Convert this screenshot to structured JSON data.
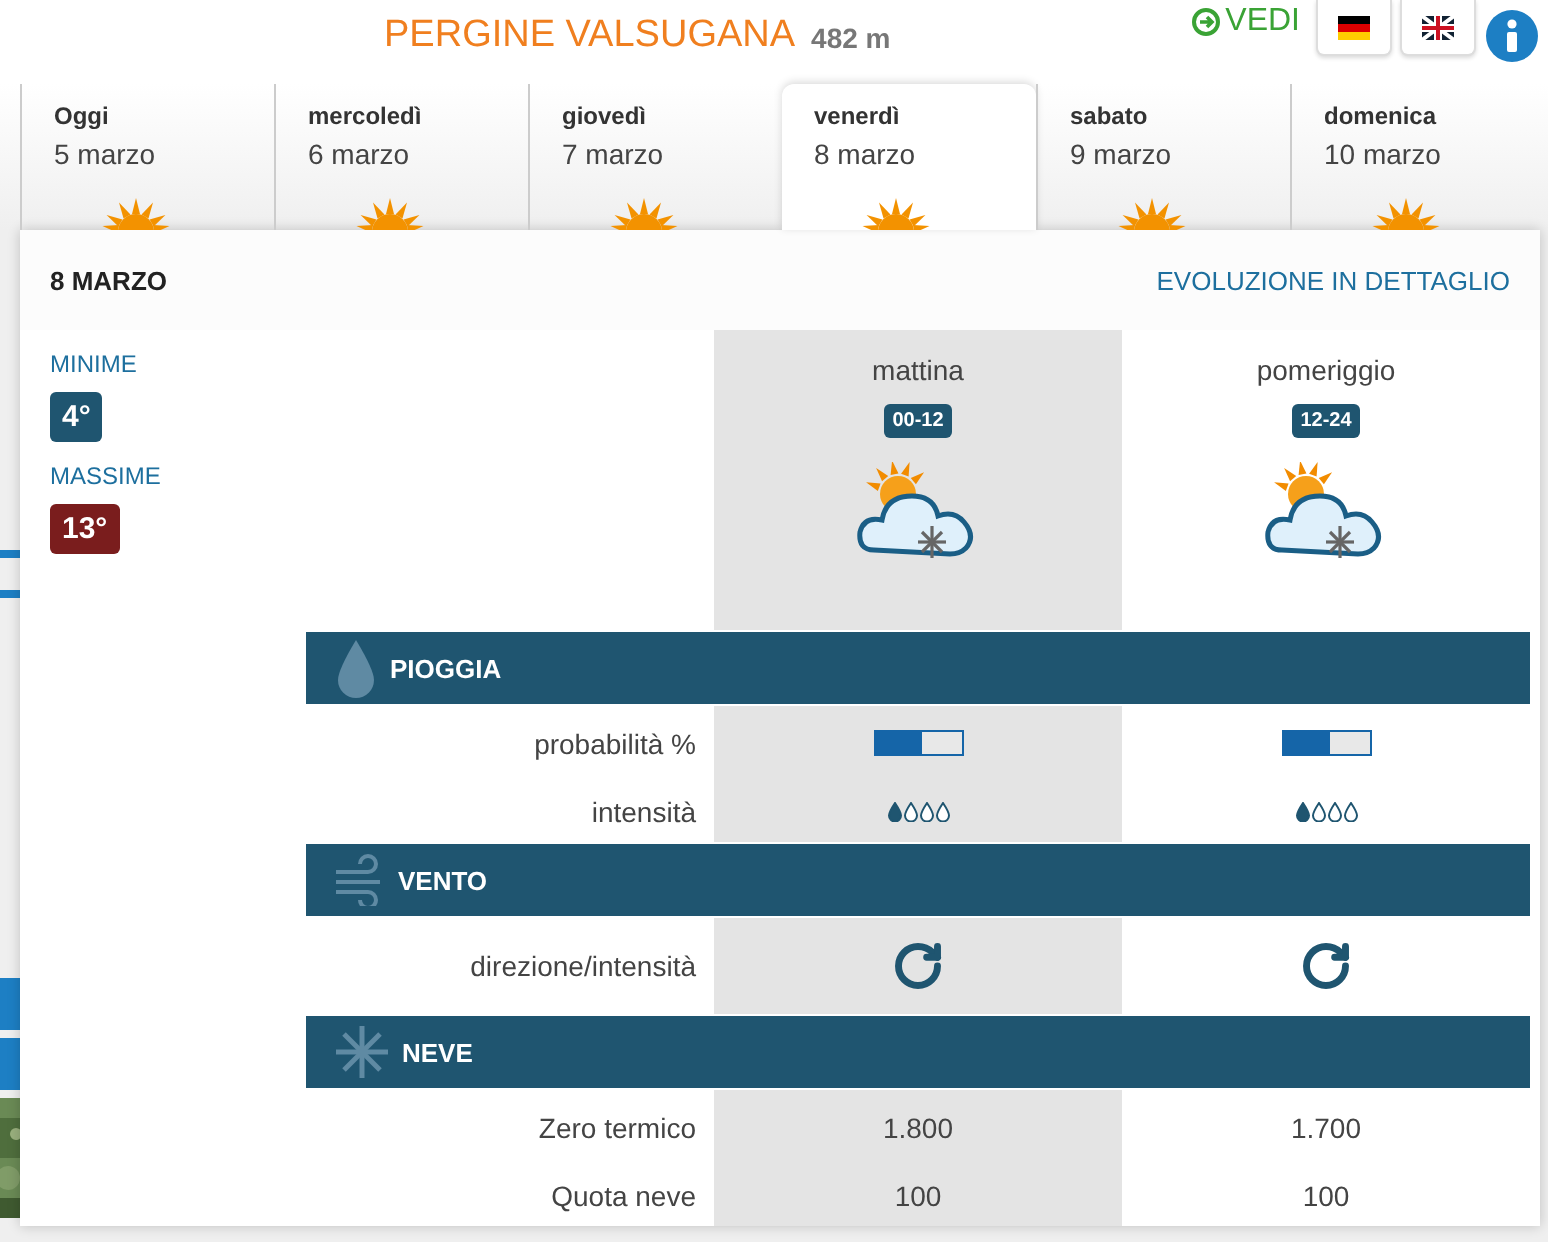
{
  "header": {
    "title": "PERGINE VALSUGANA",
    "altitude": "482 m",
    "vedi": "VEDI"
  },
  "days": [
    {
      "name": "Oggi",
      "date": "5 marzo",
      "selected": false
    },
    {
      "name": "mercoledì",
      "date": "6 marzo",
      "selected": false
    },
    {
      "name": "giovedì",
      "date": "7 marzo",
      "selected": false
    },
    {
      "name": "venerdì",
      "date": "8 marzo",
      "selected": true
    },
    {
      "name": "sabato",
      "date": "9 marzo",
      "selected": false
    },
    {
      "name": "domenica",
      "date": "10 marzo",
      "selected": false
    }
  ],
  "detail": {
    "title": "8 MARZO",
    "link": "EVOLUZIONE IN DETTAGLIO",
    "min_label": "MINIME",
    "min": "4°",
    "max_label": "MASSIME",
    "max": "13°",
    "periods": [
      {
        "name": "mattina",
        "hours": "00-12"
      },
      {
        "name": "pomeriggio",
        "hours": "12-24"
      }
    ],
    "sections": [
      {
        "kind": "rain",
        "title": "PIOGGIA",
        "rows": [
          {
            "kind": "bar",
            "label": "probabilità %",
            "values": [
              {
                "level": 0.55
              },
              {
                "level": 0.55
              }
            ]
          },
          {
            "kind": "drops",
            "label": "intensità",
            "values": [
              {
                "stars": 1
              },
              {
                "stars": 1
              }
            ]
          }
        ]
      },
      {
        "kind": "wind",
        "title": "VENTO",
        "rows": [
          {
            "kind": "wind",
            "label": "direzione/intensità"
          }
        ]
      },
      {
        "kind": "snow",
        "title": "NEVE",
        "rows": [
          {
            "kind": "text",
            "label": "Zero termico",
            "values": [
              "1.800",
              "1.700"
            ]
          },
          {
            "kind": "text",
            "label": "Quota neve",
            "values": [
              "100",
              "100"
            ]
          }
        ]
      }
    ]
  }
}
